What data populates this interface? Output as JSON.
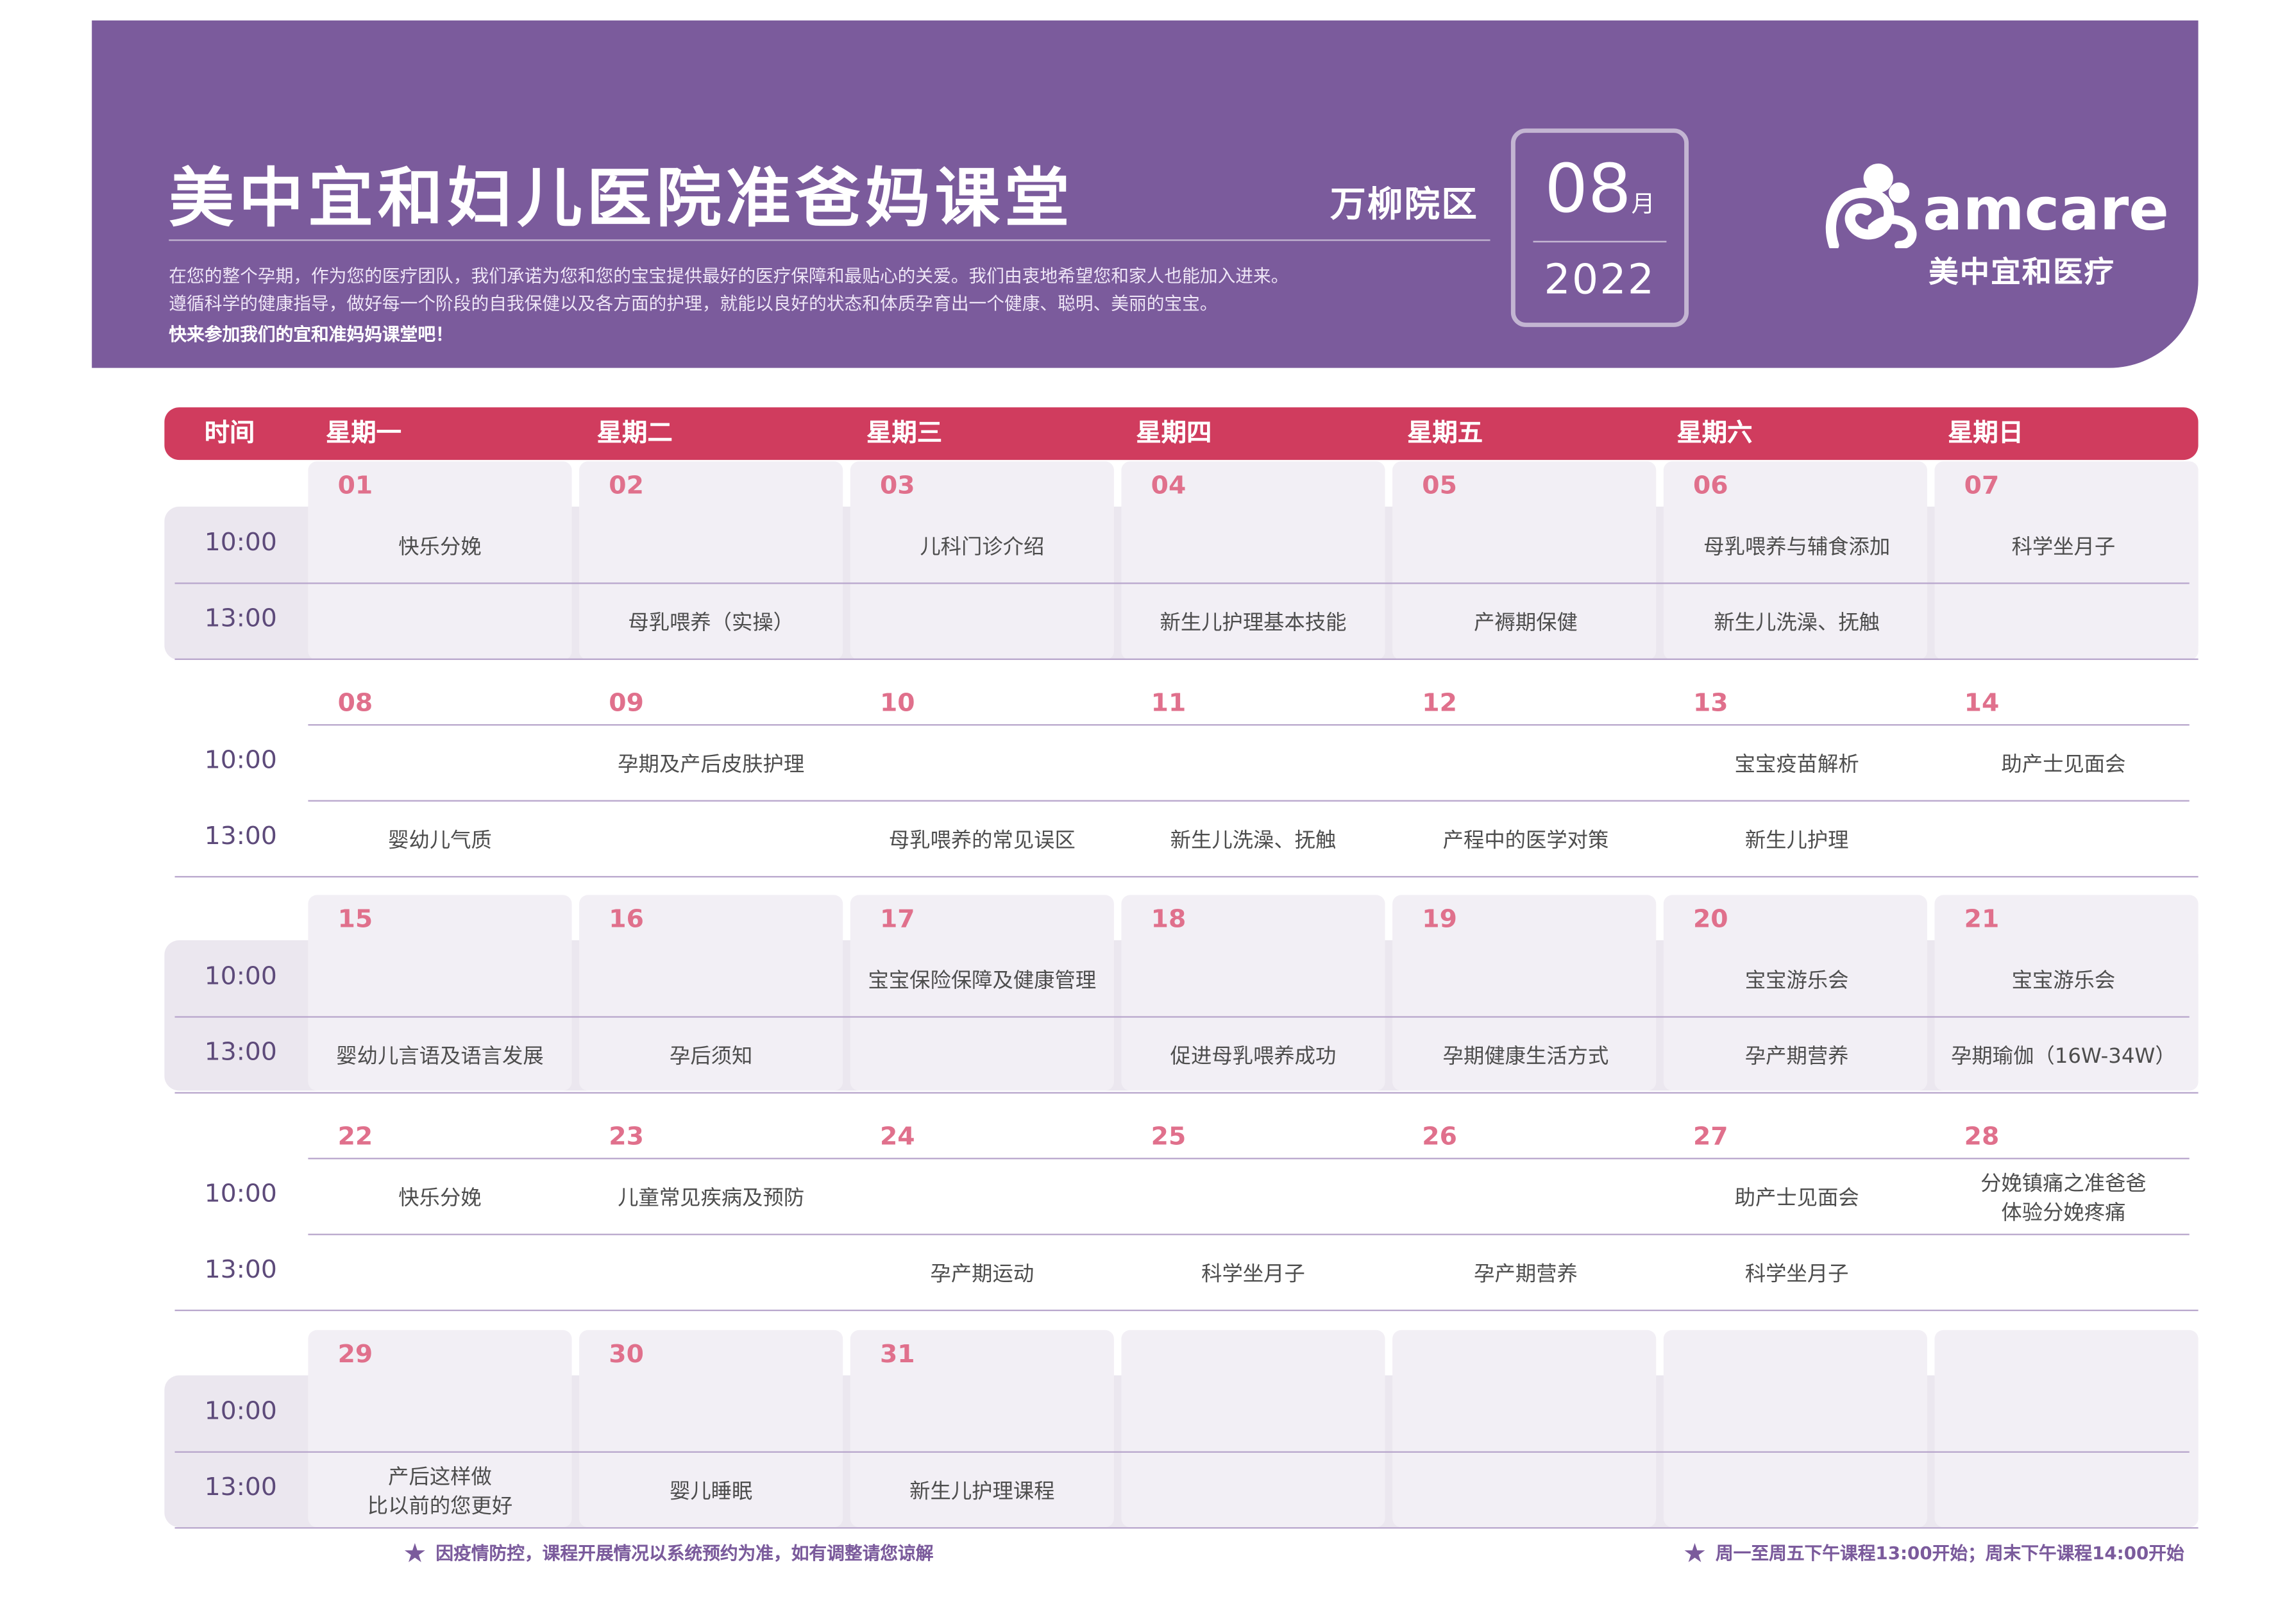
{
  "header": {
    "title": "美中宜和妇儿医院准爸妈课堂",
    "intro_line1": "在您的整个孕期，作为您的医疗团队，我们承诺为您和您的宝宝提供最好的医疗保障和最贴心的关爱。我们由衷地希望您和家人也能加入进来。",
    "intro_line2": "遵循科学的健康指导，做好每一个阶段的自我保健以及各方面的护理，就能以良好的状态和体质孕育出一个健康、聪明、美丽的宝宝。",
    "intro_line3": "快来参加我们的宜和准妈妈课堂吧！",
    "campus": "万柳院区",
    "month": "08",
    "month_unit": "月",
    "year": "2022"
  },
  "logo": {
    "brand": "amcare",
    "sub": "美中宜和医疗"
  },
  "calendar": {
    "time_header": "时间",
    "weekdays": [
      "星期一",
      "星期二",
      "星期三",
      "星期四",
      "星期五",
      "星期六",
      "星期日"
    ],
    "times": [
      "10:00",
      "13:00"
    ],
    "weeks": [
      {
        "days": [
          "01",
          "02",
          "03",
          "04",
          "05",
          "06",
          "07"
        ],
        "am": [
          "快乐分娩",
          "",
          "儿科门诊介绍",
          "",
          "",
          "母乳喂养与辅食添加",
          "科学坐月子"
        ],
        "pm": [
          "",
          "母乳喂养（实操）",
          "",
          "新生儿护理基本技能",
          "产褥期保健",
          "新生儿洗澡、抚触",
          ""
        ]
      },
      {
        "days": [
          "08",
          "09",
          "10",
          "11",
          "12",
          "13",
          "14"
        ],
        "am": [
          "",
          "孕期及产后皮肤护理",
          "",
          "",
          "",
          "宝宝疫苗解析",
          "助产士见面会"
        ],
        "pm": [
          "婴幼儿气质",
          "",
          "母乳喂养的常见误区",
          "新生儿洗澡、抚触",
          "产程中的医学对策",
          "新生儿护理",
          ""
        ]
      },
      {
        "days": [
          "15",
          "16",
          "17",
          "18",
          "19",
          "20",
          "21"
        ],
        "am": [
          "",
          "",
          "宝宝保险保障及健康管理",
          "",
          "",
          "宝宝游乐会",
          "宝宝游乐会"
        ],
        "pm": [
          "婴幼儿言语及语言发展",
          "孕后须知",
          "",
          "促进母乳喂养成功",
          "孕期健康生活方式",
          "孕产期营养",
          "孕期瑜伽（16W-34W）"
        ]
      },
      {
        "days": [
          "22",
          "23",
          "24",
          "25",
          "26",
          "27",
          "28"
        ],
        "am": [
          "快乐分娩",
          "儿童常见疾病及预防",
          "",
          "",
          "",
          "助产士见面会",
          "分娩镇痛之准爸爸\n体验分娩疼痛"
        ],
        "pm": [
          "",
          "",
          "孕产期运动",
          "科学坐月子",
          "孕产期营养",
          "科学坐月子",
          ""
        ]
      },
      {
        "days": [
          "29",
          "30",
          "31",
          "",
          "",
          "",
          ""
        ],
        "am": [
          "",
          "",
          "",
          "",
          "",
          "",
          ""
        ],
        "pm": [
          "产后这样做\n比以前的您更好",
          "婴儿睡眠",
          "新生儿护理课程",
          "",
          "",
          "",
          ""
        ]
      }
    ]
  },
  "footer": {
    "note_left": "因疫情防控，课程开展情况以系统预约为准，如有调整请您谅解",
    "note_right": "周一至周五下午课程13:00开始；周末下午课程14:00开始"
  },
  "colors": {
    "banner": "#7b5b9c",
    "header_bar": "#d03c5e",
    "day_number": "#e0708c",
    "shaded_band": "#ebe7ef"
  }
}
